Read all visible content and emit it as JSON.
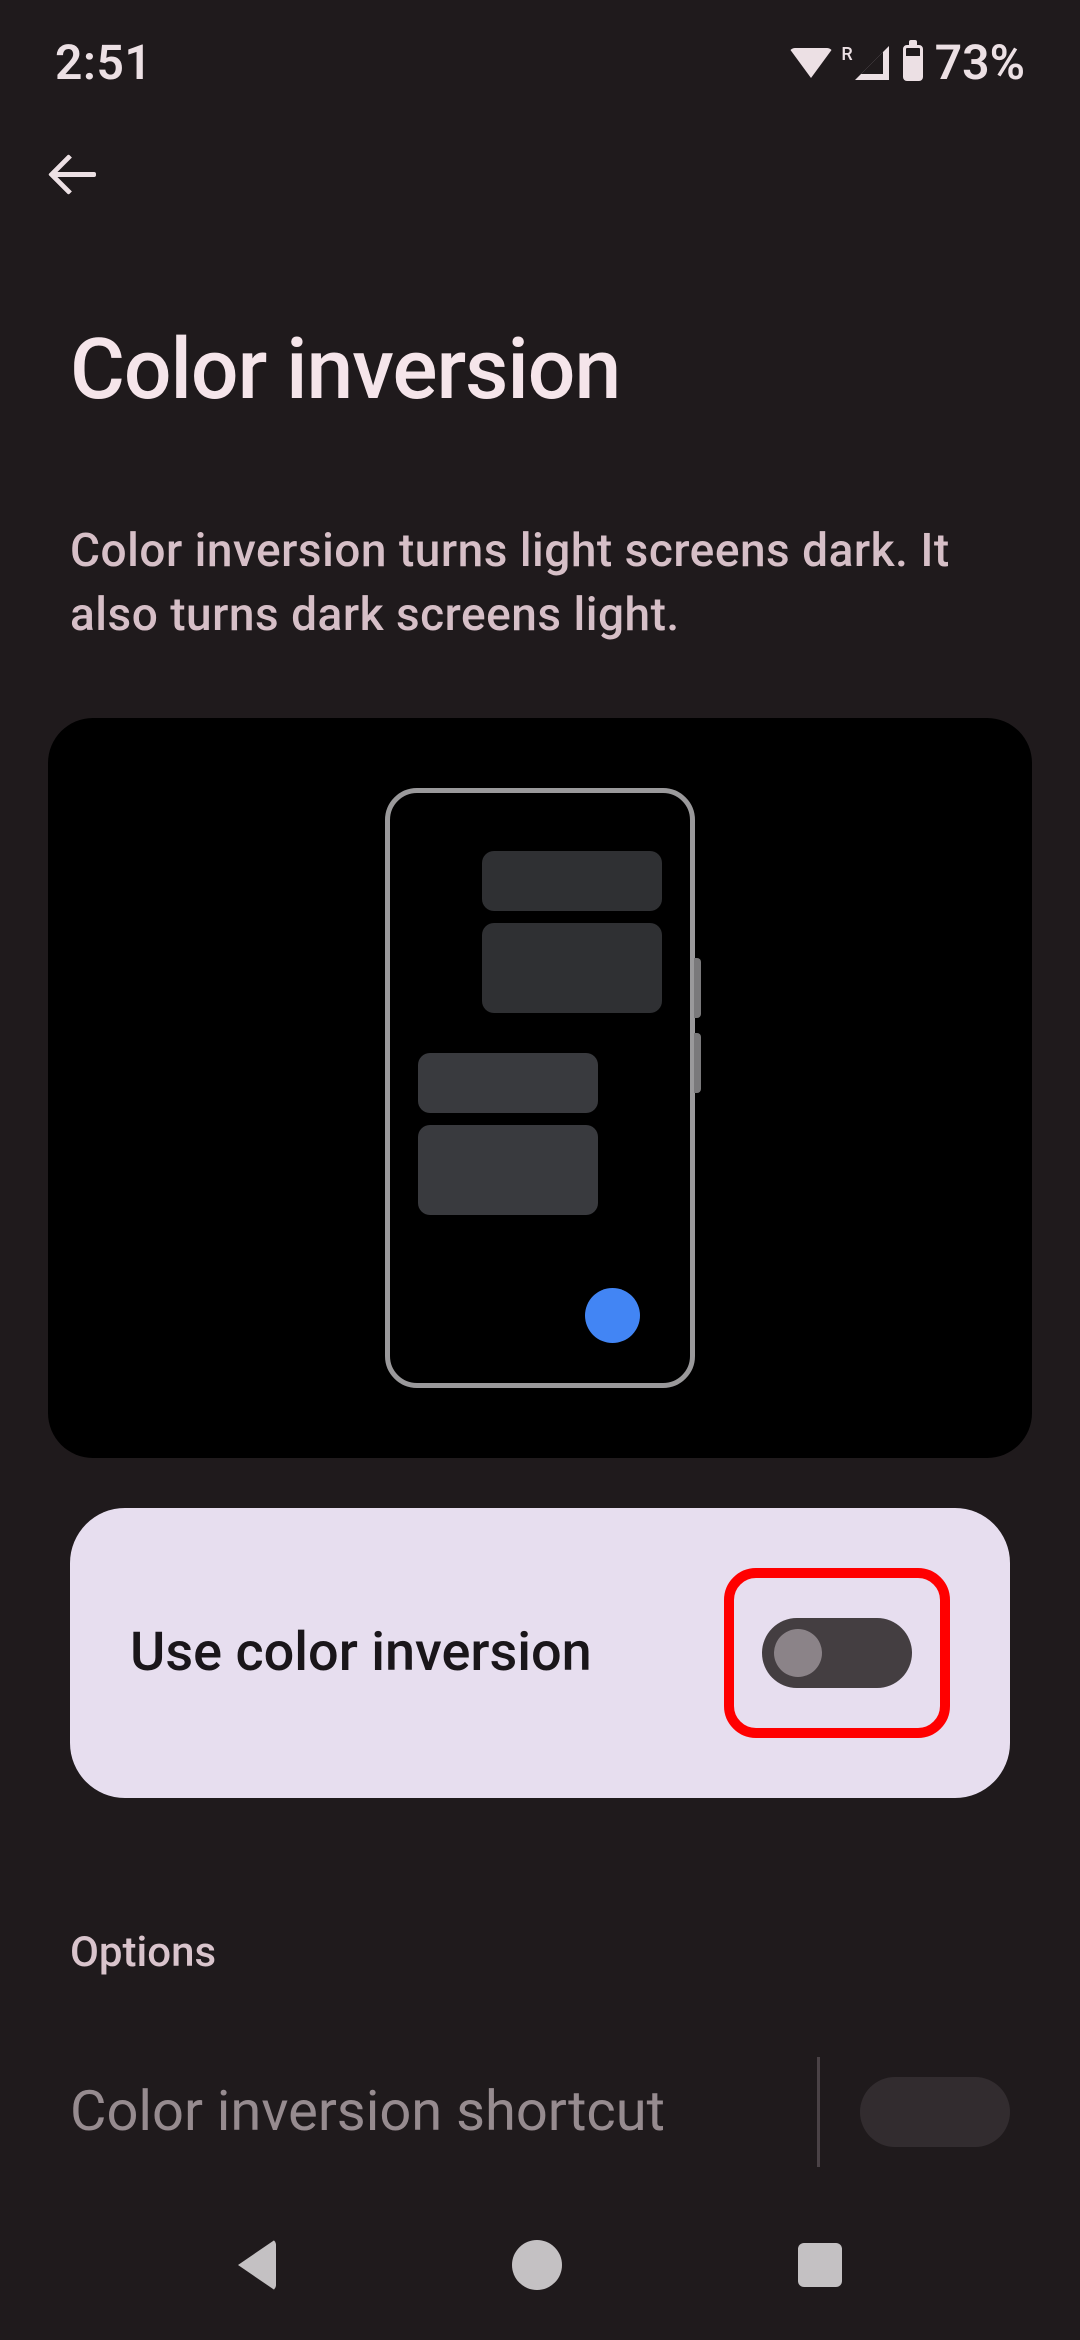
{
  "status_bar": {
    "time": "2:51",
    "network_label": "R",
    "battery_text": "73%"
  },
  "page": {
    "title": "Color inversion",
    "description": "Color inversion turns light screens dark. It also turns dark screens light."
  },
  "main_toggle": {
    "label": "Use color inversion",
    "state": "off"
  },
  "section": {
    "header": "Options"
  },
  "options": {
    "shortcut_label": "Color inversion shortcut",
    "shortcut_state": "off"
  }
}
